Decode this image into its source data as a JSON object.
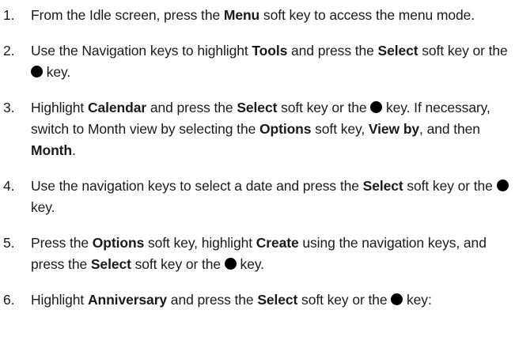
{
  "steps": [
    {
      "number": "1.",
      "segments": [
        {
          "type": "text",
          "value": "From the Idle screen, press the "
        },
        {
          "type": "bold",
          "value": "Menu"
        },
        {
          "type": "text",
          "value": " soft key to access the menu mode."
        }
      ]
    },
    {
      "number": "2.",
      "segments": [
        {
          "type": "text",
          "value": "Use the Navigation keys to highlight "
        },
        {
          "type": "bold",
          "value": "Tools"
        },
        {
          "type": "text",
          "value": " and press the "
        },
        {
          "type": "bold",
          "value": "Select"
        },
        {
          "type": "text",
          "value": " soft key or the "
        },
        {
          "type": "key",
          "icon": "center-select-key-icon"
        },
        {
          "type": "text",
          "value": " key."
        }
      ]
    },
    {
      "number": "3.",
      "segments": [
        {
          "type": "text",
          "value": "Highlight "
        },
        {
          "type": "bold",
          "value": "Calendar"
        },
        {
          "type": "text",
          "value": " and press the "
        },
        {
          "type": "bold",
          "value": "Select"
        },
        {
          "type": "text",
          "value": " soft key or the "
        },
        {
          "type": "key",
          "icon": "center-select-key-icon"
        },
        {
          "type": "text",
          "value": " key. If necessary, switch to Month view by selecting the "
        },
        {
          "type": "bold",
          "value": "Options"
        },
        {
          "type": "text",
          "value": " soft key, "
        },
        {
          "type": "bold",
          "value": "View by"
        },
        {
          "type": "text",
          "value": ", and then "
        },
        {
          "type": "bold",
          "value": "Month"
        },
        {
          "type": "text",
          "value": "."
        }
      ]
    },
    {
      "number": "4.",
      "segments": [
        {
          "type": "text",
          "value": "Use the navigation keys to select a date and press the "
        },
        {
          "type": "bold",
          "value": "Select"
        },
        {
          "type": "text",
          "value": " soft key or the "
        },
        {
          "type": "key",
          "icon": "center-select-key-icon"
        },
        {
          "type": "text",
          "value": " key."
        }
      ]
    },
    {
      "number": "5.",
      "segments": [
        {
          "type": "text",
          "value": "Press the "
        },
        {
          "type": "bold",
          "value": "Options"
        },
        {
          "type": "text",
          "value": " soft key, highlight "
        },
        {
          "type": "bold",
          "value": "Create"
        },
        {
          "type": "text",
          "value": " using the navigation keys, and press the "
        },
        {
          "type": "bold",
          "value": "Select"
        },
        {
          "type": "text",
          "value": " soft key or the "
        },
        {
          "type": "key",
          "icon": "center-select-key-icon"
        },
        {
          "type": "text",
          "value": " key."
        }
      ]
    },
    {
      "number": "6.",
      "segments": [
        {
          "type": "text",
          "value": "Highlight "
        },
        {
          "type": "bold",
          "value": "Anniversary"
        },
        {
          "type": "text",
          "value": " and press the "
        },
        {
          "type": "bold",
          "value": "Select"
        },
        {
          "type": "text",
          "value": " soft key or the "
        },
        {
          "type": "key",
          "icon": "center-select-key-icon"
        },
        {
          "type": "text",
          "value": " key:"
        }
      ]
    }
  ]
}
